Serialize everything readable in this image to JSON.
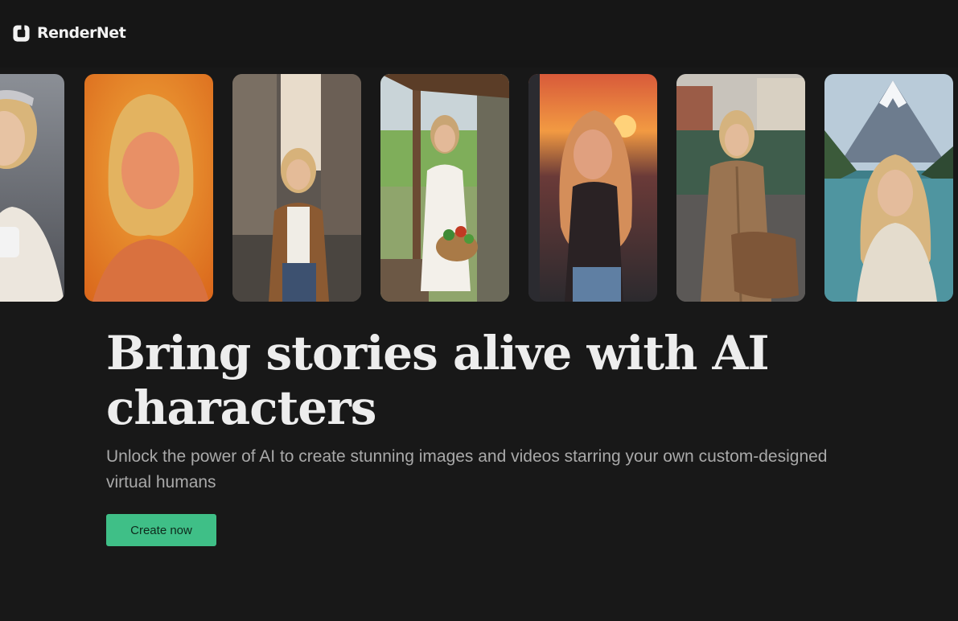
{
  "header": {
    "brand": "RenderNet",
    "logo_icon": "rendernet-logo-icon"
  },
  "gallery": {
    "items": [
      {
        "scene": "winter woman holding mug"
      },
      {
        "scene": "portrait orange glow background"
      },
      {
        "scene": "woman on city street with coffee"
      },
      {
        "scene": "woman on porch holding vegetable basket"
      },
      {
        "scene": "woman at sunset overlook"
      },
      {
        "scene": "woman in trench coat by tram"
      },
      {
        "scene": "woman at mountain lake"
      }
    ]
  },
  "hero": {
    "title": "Bring stories alive with AI characters",
    "subtitle": "Unlock the power of AI to create stunning images and videos starring your own custom-designed virtual humans",
    "cta_label": "Create now"
  },
  "colors": {
    "background": "#181818",
    "accent": "#3fbf87",
    "text": "#ececec",
    "muted_text": "#a9a9a9"
  }
}
